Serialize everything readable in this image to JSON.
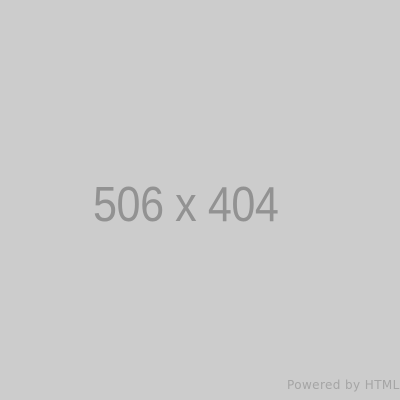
{
  "placeholder": {
    "dimensions_label": "506 x 404",
    "powered_by": "Powered by HTML"
  },
  "colors": {
    "background": "#cccccc",
    "text": "#929292",
    "footer_text": "#a5a5a5"
  }
}
